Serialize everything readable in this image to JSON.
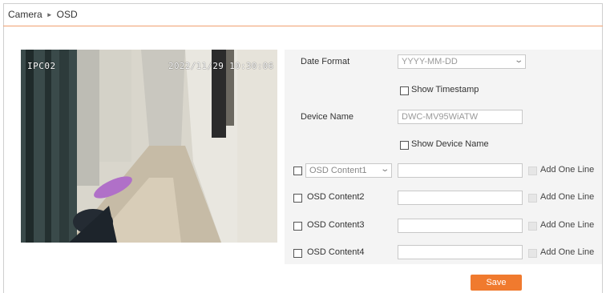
{
  "breadcrumb": {
    "root": "Camera",
    "current": "OSD"
  },
  "preview": {
    "channel": "IPC02",
    "timestamp": "2022/11/29 10:30:06"
  },
  "settings": {
    "date_format_label": "Date Format",
    "date_format_value": "YYYY-MM-DD",
    "show_timestamp_label": "Show Timestamp",
    "device_name_label": "Device Name",
    "device_name_value": "DWC-MV95WiATW",
    "show_device_name_label": "Show Device Name",
    "osd_rows": [
      {
        "label": "OSD Content1",
        "is_select": true,
        "add_line": "Add One Line"
      },
      {
        "label": "OSD Content2",
        "is_select": false,
        "add_line": "Add One Line"
      },
      {
        "label": "OSD Content3",
        "is_select": false,
        "add_line": "Add One Line"
      },
      {
        "label": "OSD Content4",
        "is_select": false,
        "add_line": "Add One Line"
      }
    ]
  },
  "save_label": "Save",
  "colors": {
    "accent": "#f07a2e",
    "panel_bg": "#f4f4f4",
    "divider": "#f0a070"
  }
}
